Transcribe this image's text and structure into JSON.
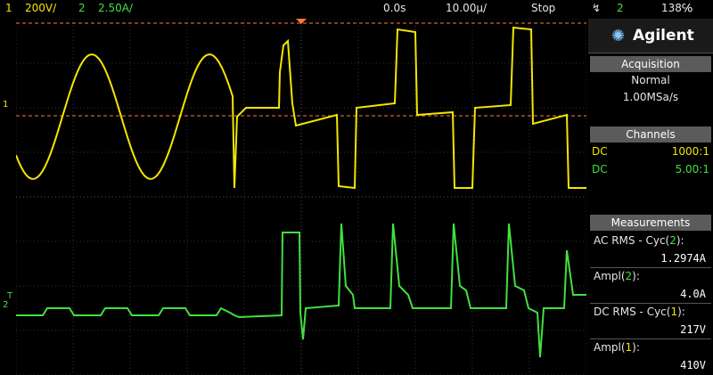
{
  "topbar": {
    "ch1_num": "1",
    "ch1_scale": "200V/",
    "ch2_num": "2",
    "ch2_scale": "2.50A/",
    "time_offset": "0.0s",
    "time_scale": "10.00µ/",
    "run_state": "Stop",
    "trigger_symbol": "↯",
    "trigger_source": "2",
    "trigger_level": "138℅"
  },
  "panel": {
    "logo_name": "Agilent",
    "acquisition": {
      "title": "Acquisition",
      "mode": "Normal",
      "rate": "1.00MSa/s"
    },
    "channels": {
      "title": "Channels",
      "items": [
        {
          "coupling": "DC",
          "probe": "1000:1",
          "color": "#f2e600"
        },
        {
          "coupling": "DC",
          "probe": "5.00:1",
          "color": "#40e040"
        }
      ]
    },
    "measurements": {
      "title": "Measurements",
      "items": [
        {
          "label_pre": "AC RMS - Cyc(",
          "ch": "2",
          "label_post": "):",
          "value": "1.2974A",
          "ch_color": "#40e040"
        },
        {
          "label_pre": "Ampl(",
          "ch": "2",
          "label_post": "):",
          "value": "4.0A",
          "ch_color": "#40e040"
        },
        {
          "label_pre": "DC RMS - Cyc(",
          "ch": "1",
          "label_post": "):",
          "value": "217V",
          "ch_color": "#f2e600"
        },
        {
          "label_pre": "Ampl(",
          "ch": "1",
          "label_post": "):",
          "value": "410V",
          "ch_color": "#f2e600"
        }
      ]
    }
  },
  "markers": {
    "ch1_marker": "1",
    "ch2_marker": "2",
    "trigger_marker": "T"
  },
  "colors": {
    "ch1": "#f2e600",
    "ch2": "#40e040",
    "trigger_level_line": "#ff7a3c",
    "grid": "#3a3a3a"
  }
}
